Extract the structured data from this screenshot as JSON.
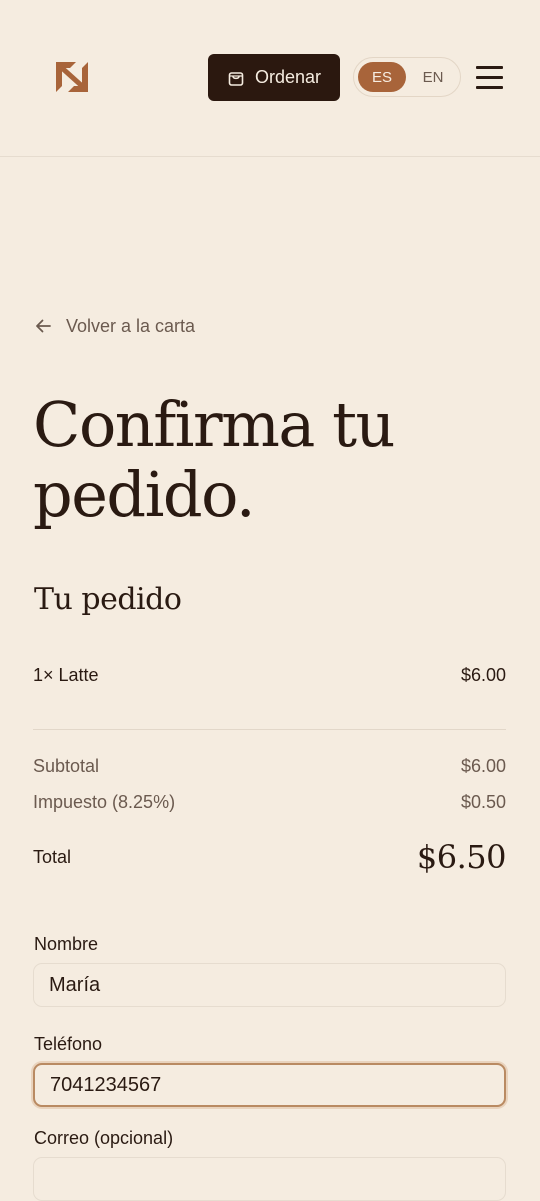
{
  "header": {
    "logo_icon": "brand-logo-icon",
    "order_button": {
      "label": "Ordenar",
      "icon": "shopping-bag-icon"
    },
    "languages": [
      {
        "code": "ES",
        "selected": true
      },
      {
        "code": "EN",
        "selected": false
      }
    ],
    "menu_icon": "hamburger-menu-icon"
  },
  "back_link": {
    "label": "Volver a la carta",
    "icon": "arrow-left-icon"
  },
  "title": {
    "line1": "Confirma tu",
    "line2": "pedido."
  },
  "order": {
    "heading": "Tu pedido",
    "items": [
      {
        "name": "1× Latte",
        "price": "$6.00"
      }
    ],
    "subtotal_label": "Subtotal",
    "subtotal_value": "$6.00",
    "tax_label": "Impuesto (8.25%)",
    "tax_value": "$0.50",
    "total_label": "Total",
    "total_value": "$6.50"
  },
  "form": {
    "name_label": "Nombre",
    "name_value": "María",
    "phone_label": "Teléfono",
    "phone_value": "7041234567",
    "email_label": "Correo (opcional)",
    "email_value": ""
  },
  "colors": {
    "background": "#f5ece0",
    "dark": "#2b180f",
    "accent": "#a8643a",
    "muted_text": "#6b5a4f"
  }
}
